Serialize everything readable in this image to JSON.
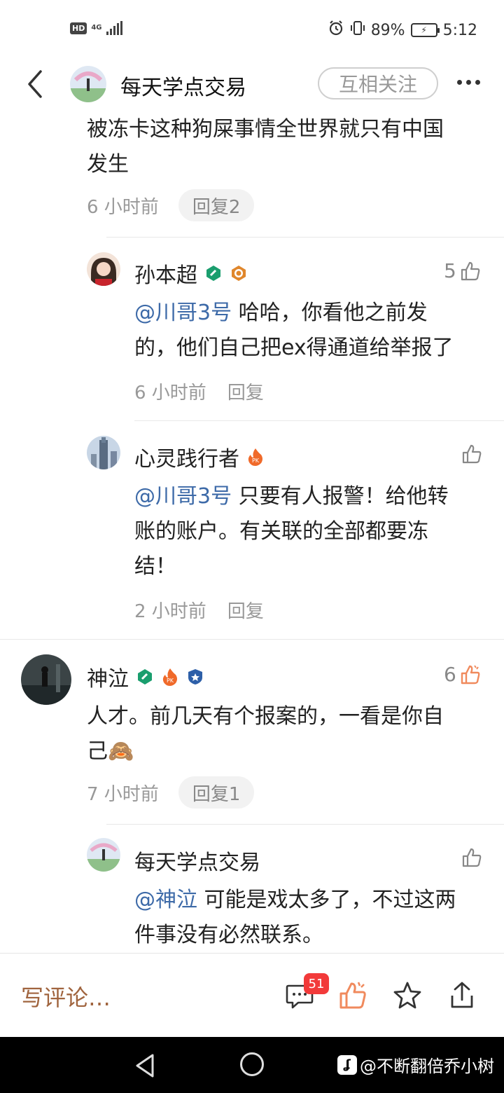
{
  "status_bar": {
    "hd": "HD",
    "network": "4G",
    "battery_pct": "89%",
    "time": "5:12"
  },
  "header": {
    "title": "每天学点交易",
    "follow_label": "互相关注"
  },
  "top_comment": {
    "text_line1": "被冻卡这种狗屎事情全世界就只有中国",
    "text_line2": "发生",
    "time": "6 小时前",
    "reply_label": "回复2"
  },
  "replies_a": [
    {
      "name": "孙本超",
      "likes": "5",
      "mention": "@川哥3号",
      "text_line1": " 哈哈，你看他之前发",
      "text_line2": "的，他们自己把ex得通道给举报了",
      "time": "6 小时前",
      "reply_label": "回复"
    },
    {
      "name": "心灵践行者",
      "mention": "@川哥3号",
      "text_line1": " 只要有人报警！给他转",
      "text_line2": "账的账户。有关联的全部都要冻",
      "text_line3": "结！",
      "time": "2 小时前",
      "reply_label": "回复"
    }
  ],
  "comment_b": {
    "name": "神泣",
    "likes": "6",
    "text_line1": "人才。前几天有个报案的，一看是你自",
    "text_line2": "己🙈",
    "time": "7 小时前",
    "reply_label": "回复1"
  },
  "reply_b": {
    "name": "每天学点交易",
    "mention": "@神泣",
    "text_line1": " 可能是戏太多了，不过这两",
    "text_line2": "件事没有必然联系。"
  },
  "bottom_bar": {
    "write_placeholder": "写评论…",
    "comment_count": "51"
  },
  "watermark": {
    "text": "@不断翻倍乔小树"
  },
  "colors": {
    "mention": "#3d6aa8",
    "write_comment": "#a0643e",
    "liked": "#f08a5d",
    "badge_red": "#f23a3a"
  }
}
